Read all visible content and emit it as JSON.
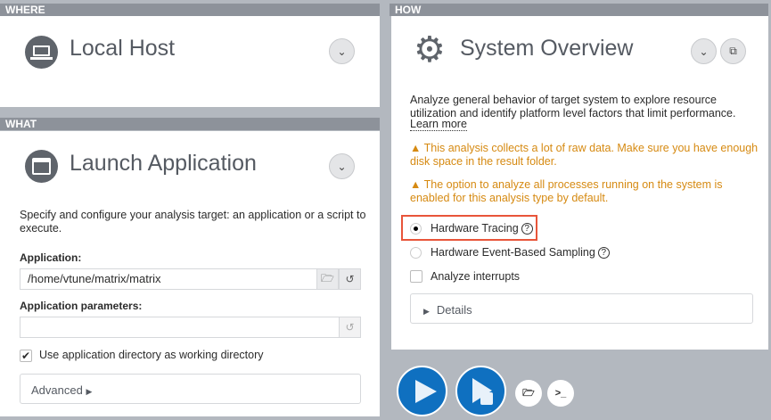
{
  "where": {
    "header": "WHERE",
    "title": "Local Host",
    "icon": "laptop-icon"
  },
  "what": {
    "header": "WHAT",
    "title": "Launch Application",
    "icon": "application-window-icon",
    "description": "Specify and configure your analysis target: an application or a script to execute.",
    "app_label": "Application:",
    "app_value": "/home/vtune/matrix/matrix",
    "params_label": "Application parameters:",
    "params_value": "",
    "use_dir_label": "Use application directory as working directory",
    "use_dir_checked": true,
    "advanced_label": "Advanced"
  },
  "how": {
    "header": "HOW",
    "title": "System Overview",
    "icon": "gear-icon",
    "description": "Analyze general behavior of target system to explore resource utilization and identify platform level factors that limit performance.",
    "learn_more": "Learn more",
    "warnings": [
      "This analysis collects a lot of raw data. Make sure you have enough disk space in the result folder.",
      "The option to analyze all processes running on the system is enabled for this analysis type by default."
    ],
    "options": [
      {
        "label": "Hardware Tracing",
        "selected": true
      },
      {
        "label": "Hardware Event-Based Sampling",
        "selected": false
      }
    ],
    "interrupts_label": "Analyze interrupts",
    "interrupts_checked": false,
    "details_label": "Details"
  },
  "colors": {
    "accent": "#0f70c0",
    "warning": "#d68a12",
    "highlight": "#e8553a"
  }
}
